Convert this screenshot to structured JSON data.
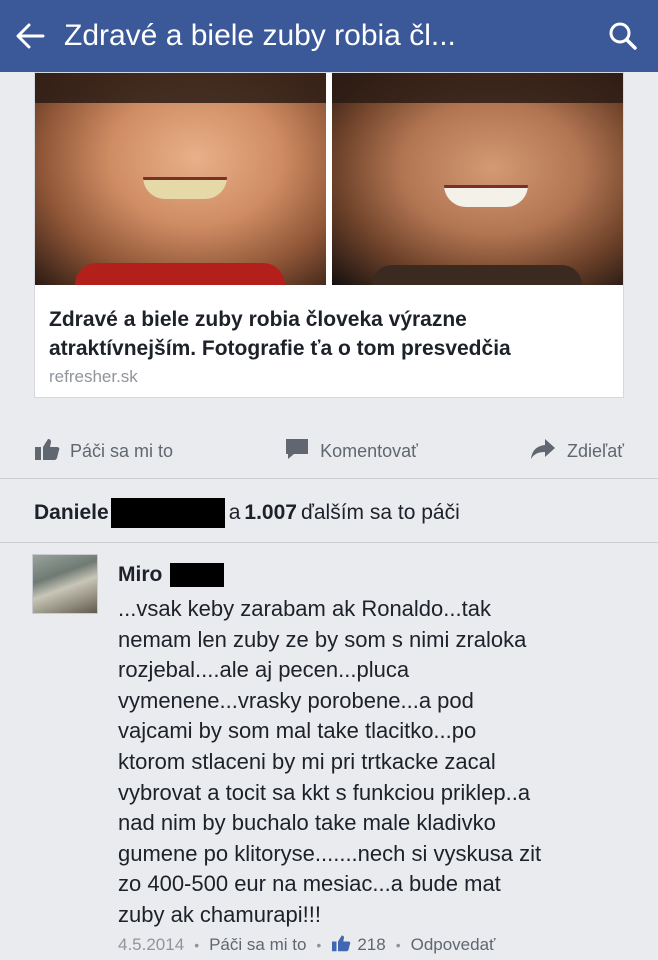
{
  "appbar": {
    "title": "Zdravé a biele zuby robia čl...",
    "back_icon": "back-arrow-icon",
    "search_icon": "search-icon",
    "background_color": "#3b5998"
  },
  "link_card": {
    "title": "Zdravé a biele zuby robia človeka výrazne atraktívnejším. Fotografie ťa o tom presvedčia",
    "domain": "refresher.sk"
  },
  "actions": {
    "like": "Páči sa mi to",
    "comment": "Komentovať",
    "share": "Zdieľať"
  },
  "likes": {
    "name": "Daniele",
    "prefix": "a",
    "count": "1.007",
    "suffix": "ďalším sa to páči"
  },
  "comment": {
    "author": "Miro",
    "text": "...vsak keby zarabam ak Ronaldo...tak\nnemam len zuby ze by som s nimi zraloka\nrozjebal....ale aj pecen...pluca\nvymenene...vrasky porobene...a pod\nvajcami by som mal take tlacitko...po\nktorom stlaceni by mi pri trtkacke zacal\nvybrovat a tocit sa kkt s funkciou priklep..a\nnad nim by buchalo take male kladivko\ngumene po klitoryse.......nech si vyskusa zit\nzo 400-500 eur na mesiac...a bude mat\nzuby ak chamurapi!!!",
    "date": "4.5.2014",
    "like_label": "Páči sa mi to",
    "like_count": "218",
    "reply_label": "Odpovedať"
  }
}
